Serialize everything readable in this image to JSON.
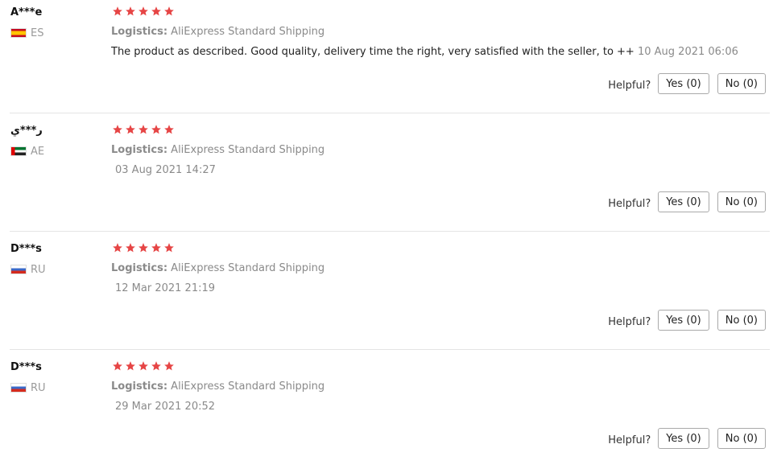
{
  "colors": {
    "star": "#e64545",
    "muted": "#8a8a8a",
    "divider": "#e4e4e4"
  },
  "reviews": [
    {
      "username": "A***e",
      "country": "ES",
      "flag_icon": "spain-flag-icon",
      "rating": 5,
      "logistics_label": "Logistics:",
      "logistics_value": "AliExpress Standard Shipping",
      "text": "The product as described. Good quality, delivery time the right, very satisfied with the seller, to ++",
      "date": "10 Aug 2021 06:06",
      "helpful_label": "Helpful?",
      "yes_label": "Yes (0)",
      "no_label": "No (0)"
    },
    {
      "username": "ر***ي",
      "country": "AE",
      "flag_icon": "uae-flag-icon",
      "rating": 5,
      "logistics_label": "Logistics:",
      "logistics_value": "AliExpress Standard Shipping",
      "text": "",
      "date": "03 Aug 2021 14:27",
      "helpful_label": "Helpful?",
      "yes_label": "Yes (0)",
      "no_label": "No (0)"
    },
    {
      "username": "D***s",
      "country": "RU",
      "flag_icon": "russia-flag-icon",
      "rating": 5,
      "logistics_label": "Logistics:",
      "logistics_value": "AliExpress Standard Shipping",
      "text": "",
      "date": "12 Mar 2021 21:19",
      "helpful_label": "Helpful?",
      "yes_label": "Yes (0)",
      "no_label": "No (0)"
    },
    {
      "username": "D***s",
      "country": "RU",
      "flag_icon": "russia-flag-icon",
      "rating": 5,
      "logistics_label": "Logistics:",
      "logistics_value": "AliExpress Standard Shipping",
      "text": "",
      "date": "29 Mar 2021 20:52",
      "helpful_label": "Helpful?",
      "yes_label": "Yes (0)",
      "no_label": "No (0)"
    }
  ]
}
